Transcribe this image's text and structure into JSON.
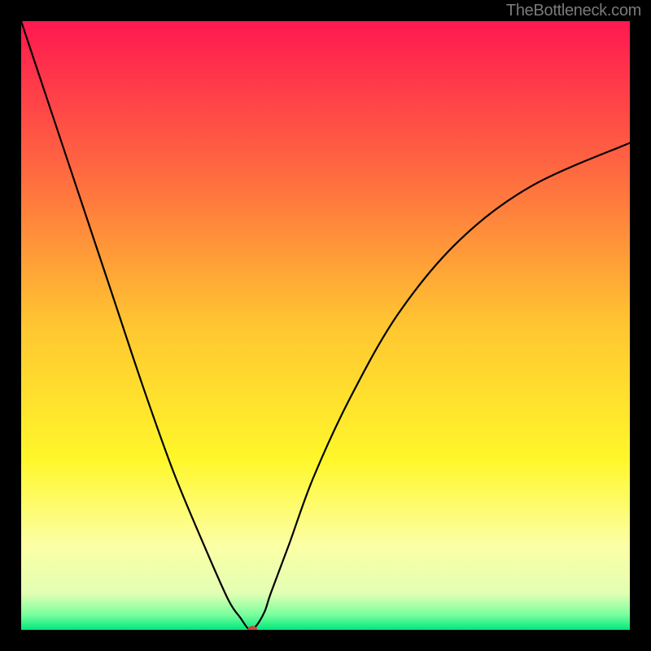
{
  "watermark": "TheBottleneck.com",
  "chart_data": {
    "type": "line",
    "title": "",
    "xlabel": "",
    "ylabel": "",
    "xlim": [
      0,
      100
    ],
    "ylim": [
      0,
      100
    ],
    "gradient_background": {
      "type": "vertical",
      "stops": [
        {
          "pos": 0.0,
          "color": "#ff1850"
        },
        {
          "pos": 0.25,
          "color": "#ff6a40"
        },
        {
          "pos": 0.5,
          "color": "#ffc631"
        },
        {
          "pos": 0.72,
          "color": "#fff72a"
        },
        {
          "pos": 0.86,
          "color": "#fcffa4"
        },
        {
          "pos": 0.94,
          "color": "#e2ffb4"
        },
        {
          "pos": 0.975,
          "color": "#7aff9e"
        },
        {
          "pos": 1.0,
          "color": "#00e87d"
        }
      ]
    },
    "series": [
      {
        "name": "bottleneck-curve",
        "x": [
          0,
          5,
          10,
          15,
          20,
          25,
          30,
          34,
          36,
          37.5,
          38.5,
          40,
          41,
          44,
          48,
          54,
          62,
          72,
          84,
          100
        ],
        "y": [
          100,
          85,
          70,
          55,
          40,
          26,
          14,
          5,
          2,
          0,
          0.5,
          3,
          6,
          14,
          25,
          38,
          52,
          64,
          73,
          80
        ]
      }
    ],
    "marker": {
      "name": "optimum-marker",
      "x": 38,
      "y": 0,
      "rx": 6,
      "ry": 5,
      "color": "#c34a3a"
    }
  }
}
